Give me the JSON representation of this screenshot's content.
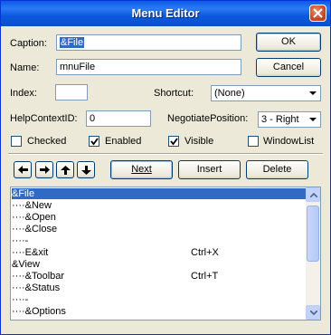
{
  "window": {
    "title": "Menu Editor"
  },
  "form": {
    "caption_label": "Caption:",
    "caption_value": "&File",
    "name_label": "Name:",
    "name_value": "mnuFile",
    "index_label": "Index:",
    "index_value": "",
    "shortcut_label": "Shortcut:",
    "shortcut_value": "(None)",
    "helpcontextid_label": "HelpContextID:",
    "helpcontextid_value": "0",
    "negotiateposition_label": "NegotiatePosition:",
    "negotiateposition_value": "3 - Right"
  },
  "checks": {
    "checked_label": "Checked",
    "checked_value": false,
    "enabled_label": "Enabled",
    "enabled_value": true,
    "visible_label": "Visible",
    "visible_value": true,
    "windowlist_label": "WindowList",
    "windowlist_value": false
  },
  "buttons": {
    "ok": "OK",
    "cancel": "Cancel",
    "next": "Next",
    "insert": "Insert",
    "delete": "Delete"
  },
  "arrows": [
    "arrow-left-icon",
    "arrow-right-icon",
    "arrow-up-icon",
    "arrow-down-icon"
  ],
  "menu_items": [
    {
      "text": "&File",
      "shortcut": "",
      "selected": true
    },
    {
      "text": "····&New",
      "shortcut": ""
    },
    {
      "text": "····&Open",
      "shortcut": ""
    },
    {
      "text": "····&Close",
      "shortcut": ""
    },
    {
      "text": "····-",
      "shortcut": ""
    },
    {
      "text": "····E&xit",
      "shortcut": "Ctrl+X"
    },
    {
      "text": "&View",
      "shortcut": ""
    },
    {
      "text": "····&Toolbar",
      "shortcut": "Ctrl+T"
    },
    {
      "text": "····&Status",
      "shortcut": ""
    },
    {
      "text": "····-",
      "shortcut": ""
    },
    {
      "text": "····&Options",
      "shortcut": ""
    }
  ],
  "colors": {
    "title_bar": "#0a5ae6",
    "selection": "#316ac5",
    "dialog_face": "#ece9d8"
  }
}
